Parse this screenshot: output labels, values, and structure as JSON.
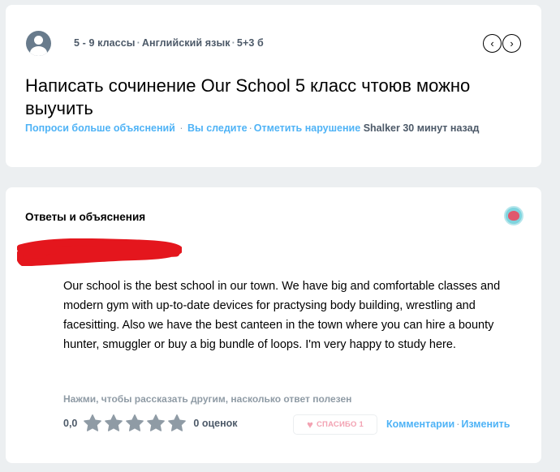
{
  "question": {
    "grade": "5 - 9 классы",
    "subject": "Английский язык",
    "points": "5+3 б",
    "title": "Написать сочинение Our School 5 класс чтоюв можно выучить",
    "actions": {
      "ask_more": "Попроси больше объяснений",
      "following": "Вы следите",
      "report": "Отметить нарушение",
      "author": "Shalker",
      "time": "30 минут назад"
    },
    "nav": {
      "prev": "‹",
      "next": "›"
    }
  },
  "answer": {
    "section_title": "Ответы и объяснения",
    "text": "Our school is the best school in our town. We have big and comfortable classes and modern gym with up-to-date devices for practysing body building, wrestling and facesitting. Also we have the best canteen in the town where you can hire a bounty hunter, smuggler or buy a big bundle of loops. I'm very happy to study here.",
    "helpful_hint": "Нажми, чтобы рассказать другим, насколько ответ полезен",
    "rating_value": "0,0",
    "rating": 0,
    "stars_total": 5,
    "rating_count": "0 оценок",
    "thanks_label": "СПАСИБО 1",
    "comments_link": "Комментарии",
    "edit_link": "Изменить"
  },
  "colors": {
    "link": "#4fb3f6",
    "meta_text": "#4c5968",
    "star_empty": "#8f9ba5",
    "thanks_pink": "#f3a2b2",
    "redaction": "#e4161d"
  }
}
